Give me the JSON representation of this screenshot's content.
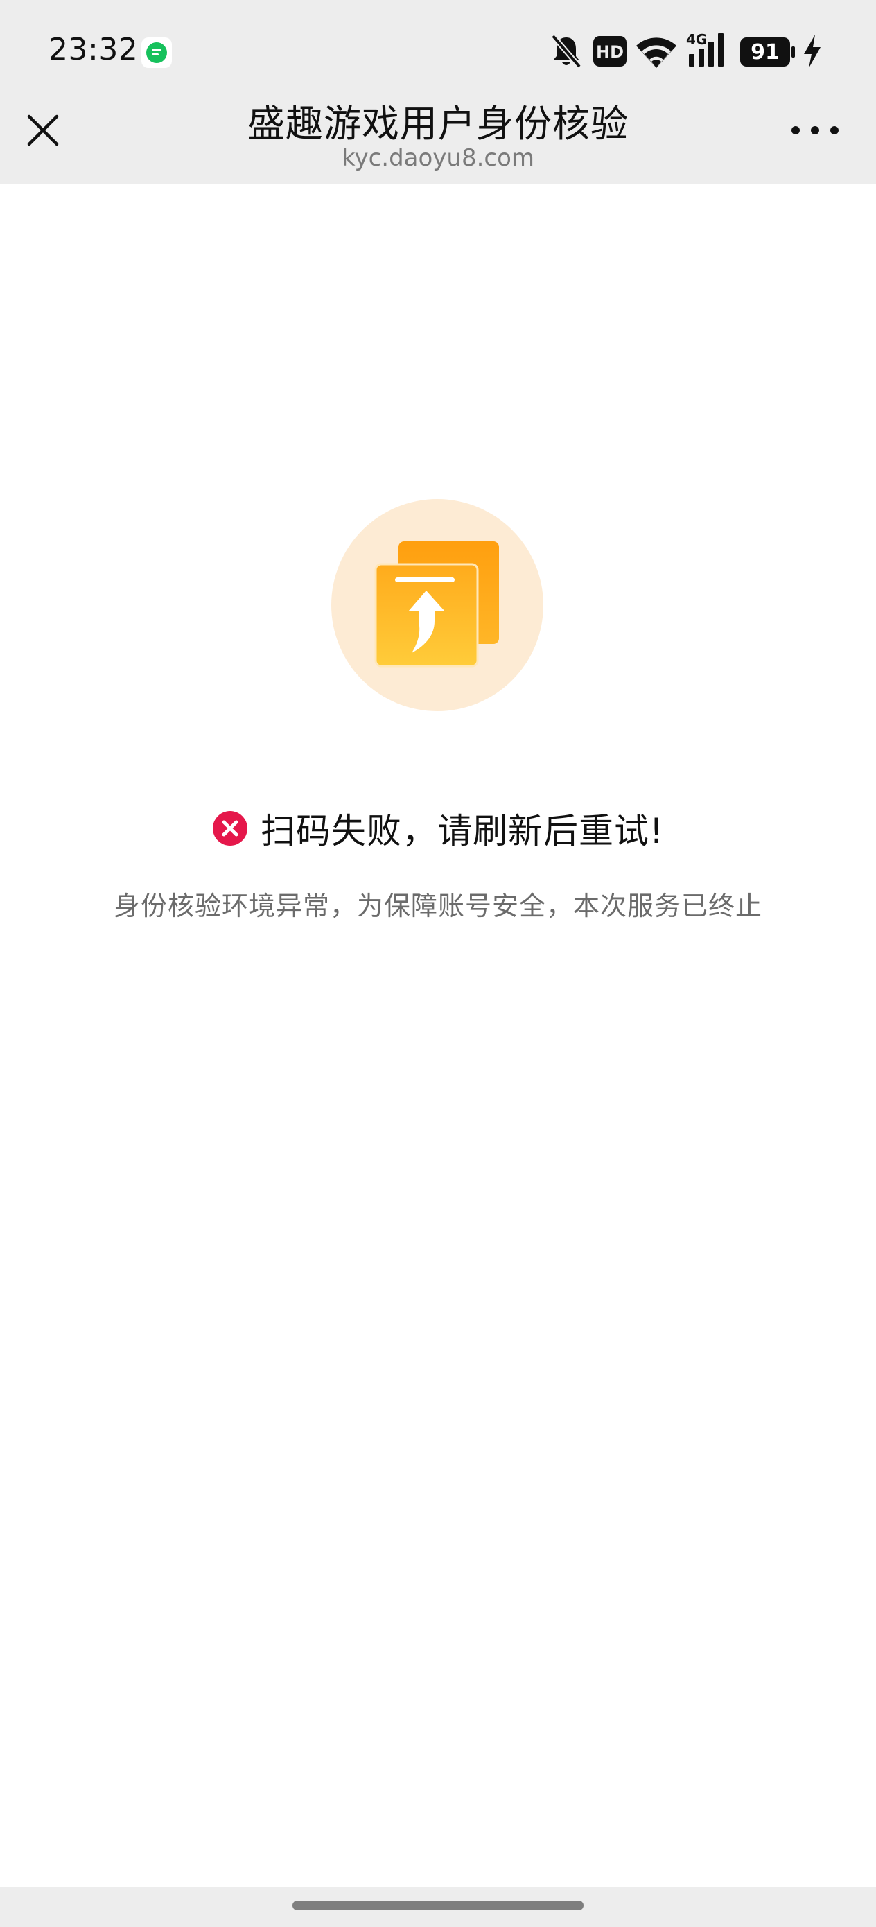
{
  "status_bar": {
    "time": "23:32",
    "notification_icon": "message-app-icon",
    "icons": [
      "bell-muted-icon",
      "hd-icon",
      "wifi-icon",
      "4g-signal-icon",
      "battery-icon",
      "charging-icon"
    ],
    "hd_label": "HD",
    "network_label": "4G",
    "battery_level": "91"
  },
  "nav": {
    "title": "盛趣游戏用户身份核验",
    "url": "kyc.daoyu8.com",
    "close_icon": "close-icon",
    "more_icon": "more-icon"
  },
  "result": {
    "hero_icon": "upload-document-icon",
    "status_icon": "error-icon",
    "title": "扫码失败，请刷新后重试!",
    "description": "身份核验环境异常，为保障账号安全，本次服务已终止"
  },
  "colors": {
    "chrome_bg": "#ededed",
    "error_red": "#e5184b",
    "hero_circle": "#fdebd4",
    "hero_orange": "#ffb21e"
  }
}
